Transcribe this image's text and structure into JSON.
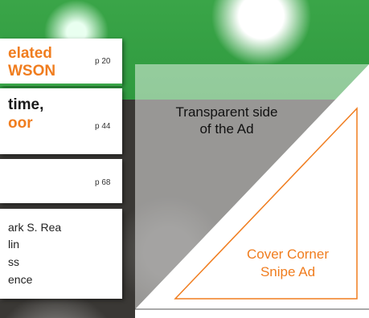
{
  "toc": {
    "entry1": {
      "line1": "elated",
      "line2": "WSON",
      "page": "p 20"
    },
    "entry2": {
      "line1": "time,",
      "line2": "oor",
      "page": "p 44"
    },
    "entry3": {
      "page": "p 68"
    },
    "entry4": {
      "names": [
        "ark S. Rea",
        "lin",
        "ss",
        "ence"
      ]
    }
  },
  "ad": {
    "transparent_label": "Transparent side of the Ad",
    "transparent_line1": "Transparent side",
    "transparent_line2": "of the Ad",
    "snipe_line1": "Cover Corner",
    "snipe_line2": "Snipe Ad"
  },
  "colors": {
    "green": "#3aa548",
    "orange": "#f07d1f"
  }
}
